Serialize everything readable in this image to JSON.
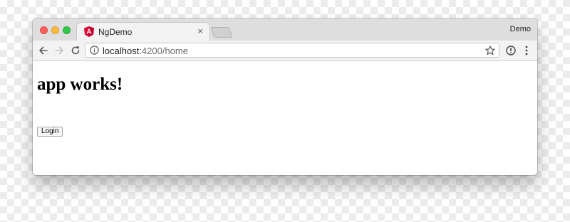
{
  "tab": {
    "title": "NgDemo",
    "close_glyph": "×",
    "favicon": "angular-logo-icon"
  },
  "profile": {
    "name": "Demo"
  },
  "address_bar": {
    "host": "localhost",
    "path": ":4200/home"
  },
  "page": {
    "heading": "app works!",
    "login_label": "Login"
  },
  "icons": {
    "back": "arrow-left-icon",
    "forward": "arrow-right-icon",
    "reload": "reload-icon",
    "info": "info-icon",
    "bookmark": "star-icon",
    "extension": "extension-icon",
    "menu": "kebab-menu-icon"
  },
  "colors": {
    "close": "#fc605c",
    "minimize": "#fdbc40",
    "maximize": "#34c84a",
    "angular": "#dd0031"
  }
}
